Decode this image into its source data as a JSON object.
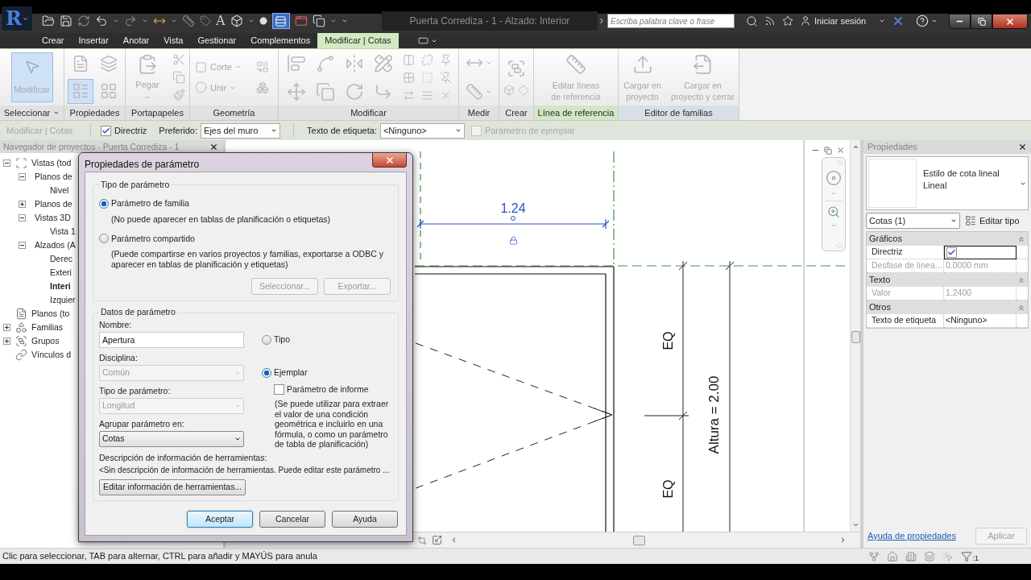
{
  "app_button": {
    "label": "R"
  },
  "quick_access": {
    "text_glyph": "A",
    "toggle_on": true
  },
  "window": {
    "title": "Puerta Corrediza - 1 - Alzado: Interior"
  },
  "search": {
    "placeholder": "Escriba palabra clave o frase"
  },
  "account": {
    "label": "Iniciar sesión"
  },
  "ribbon": {
    "tabs": [
      {
        "label": "Crear",
        "selected": false
      },
      {
        "label": "Insertar",
        "selected": false
      },
      {
        "label": "Anotar",
        "selected": false
      },
      {
        "label": "Vista",
        "selected": false
      },
      {
        "label": "Gestionar",
        "selected": false
      },
      {
        "label": "Complementos",
        "selected": false
      },
      {
        "label": "Modificar | Cotas",
        "selected": true
      }
    ],
    "panels": [
      {
        "label": "Seleccionar",
        "kind": "standard",
        "menu": true,
        "tools": [
          {
            "label": "Modificar",
            "selected": true
          }
        ]
      },
      {
        "label": "Propiedades",
        "kind": "standard",
        "tools": [
          {
            "selected": false
          },
          {
            "selected": false
          },
          {
            "selected": true
          },
          {
            "selected": false
          }
        ]
      },
      {
        "label": "Portapapeles",
        "kind": "standard",
        "tools": [
          {
            "label": "Pegar"
          }
        ]
      },
      {
        "label": "Geometría",
        "kind": "standard",
        "tools": [
          {
            "label": "Corte"
          },
          {
            "label": "Unir"
          }
        ]
      },
      {
        "label": "Modificar",
        "kind": "standard"
      },
      {
        "label": "Medir",
        "kind": "standard"
      },
      {
        "label": "Crear",
        "kind": "standard"
      },
      {
        "label": "Línea de referencia",
        "kind": "contextual",
        "tools": [
          {
            "label": "Editar líneas de referencia"
          }
        ]
      },
      {
        "label": "Editor de familias",
        "kind": "family",
        "tools": [
          {
            "label": "Cargar en proyecto"
          },
          {
            "label": "Cargar en proyecto y cerrar"
          }
        ]
      }
    ]
  },
  "options_bar": {
    "context": "Modificar | Cotas",
    "leader": {
      "label": "Directriz",
      "checked": true,
      "disabled": false
    },
    "preferred": {
      "label": "Preferido:",
      "value": "Ejes del muro"
    },
    "label_text": {
      "label": "Texto de etiqueta:",
      "value": "<Ninguno>"
    },
    "instance": {
      "label": "Parámetro de ejemplar",
      "checked": false,
      "disabled": true
    }
  },
  "project_browser": {
    "title": "Navegador de proyectos - Puerta Corrediza - 1",
    "items": [
      {
        "label": "Vistas (tod",
        "kind": "views",
        "expanded": true,
        "children": [
          {
            "label": "Planos de",
            "expanded": true,
            "children": [
              {
                "label": "Nivel",
                "current": false
              }
            ]
          },
          {
            "label": "Planos de",
            "expanded": false
          },
          {
            "label": "Vistas 3D",
            "expanded": true,
            "children": [
              {
                "label": "Vista 1",
                "current": false
              }
            ]
          },
          {
            "label": "Alzados (A",
            "expanded": true,
            "children": [
              {
                "label": "Derec",
                "current": false
              },
              {
                "label": "Exteri",
                "current": false
              },
              {
                "label": "Interi",
                "current": true
              },
              {
                "label": "Izquier",
                "current": false
              }
            ]
          }
        ]
      },
      {
        "label": "Planos (to",
        "kind": "sheets"
      },
      {
        "label": "Familias",
        "kind": "families",
        "expanded": false
      },
      {
        "label": "Grupos",
        "kind": "groups",
        "expanded": false
      },
      {
        "label": "Vínculos d",
        "kind": "links"
      }
    ]
  },
  "view": {
    "dimension": "1.24",
    "annotations": [
      "EQ",
      "Altura = 2.00",
      "EQ"
    ]
  },
  "properties": {
    "title": "Propiedades",
    "type_name": "Estilo de cota lineal",
    "type_value": "Lineal",
    "selector": "Cotas (1)",
    "edit_type": "Editar tipo",
    "groups": [
      {
        "label": "Gráficos",
        "expanded": true,
        "rows": [
          {
            "name": "Directriz",
            "kind": "checkbox",
            "checked": true,
            "disabled": false,
            "focused": true
          },
          {
            "name": "Desfase de línea...",
            "kind": "text",
            "value": "0.0000 mm",
            "disabled": true,
            "focused": false
          }
        ]
      },
      {
        "label": "Texto",
        "expanded": true,
        "rows": [
          {
            "name": "Valor",
            "kind": "text",
            "value": "1.2400",
            "disabled": true,
            "focused": false
          }
        ]
      },
      {
        "label": "Otros",
        "expanded": true,
        "rows": [
          {
            "name": "Texto de etiqueta",
            "kind": "text",
            "value": "<Ninguno>",
            "disabled": false,
            "focused": false
          }
        ]
      }
    ],
    "help_link": "Ayuda de propiedades",
    "apply": {
      "label": "Aplicar",
      "disabled": true
    }
  },
  "status_bar": {
    "message": "Clic para seleccionar, TAB para alternar, CTRL para añadir y MAYÚS para anula",
    "filter_count": ":1"
  },
  "dialog": {
    "title": "Propiedades de parámetro",
    "type_group": {
      "title": "Tipo de parámetro",
      "options": [
        {
          "label": "Parámetro de familia",
          "selected": true,
          "note": "(No puede aparecer en tablas de planificación o etiquetas)"
        },
        {
          "label": "Parámetro compartido",
          "selected": false,
          "note": "(Puede compartirse en varios proyectos y familias, exportarse a ODBC y aparecer en tablas de planificación y etiquetas)"
        }
      ],
      "buttons": [
        {
          "label": "Seleccionar...",
          "disabled": true
        },
        {
          "label": "Exportar...",
          "disabled": true
        }
      ]
    },
    "data_group": {
      "title": "Datos de parámetro",
      "fields": [
        {
          "label": "Nombre:",
          "kind": "text",
          "value": "Apertura",
          "disabled": false
        },
        {
          "label": "Disciplina:",
          "kind": "select",
          "value": "Común",
          "disabled": true
        },
        {
          "label": "Tipo de parámetro:",
          "kind": "select",
          "value": "Longitud",
          "disabled": true
        },
        {
          "label": "Agrupar parámetro en:",
          "kind": "select",
          "value": "Cotas",
          "disabled": false
        }
      ],
      "scope": [
        {
          "label": "Tipo",
          "selected": false
        },
        {
          "label": "Ejemplar",
          "selected": true
        }
      ],
      "report": {
        "label": "Parámetro de informe",
        "checked": false,
        "note": "(Se puede utilizar para extraer el valor de una condición geométrica e incluirlo en una fórmula, o como un parámetro de tabla de planificación)"
      },
      "tooltip": {
        "label": "Descripción de información de herramientas:",
        "text": "<Sin descripción de información de herramientas. Puede editar este parámetro ...",
        "button": "Editar información de herramientas..."
      }
    },
    "buttons": [
      {
        "label": "Aceptar",
        "default": true
      },
      {
        "label": "Cancelar",
        "default": false
      },
      {
        "label": "Ayuda",
        "default": false
      }
    ]
  }
}
